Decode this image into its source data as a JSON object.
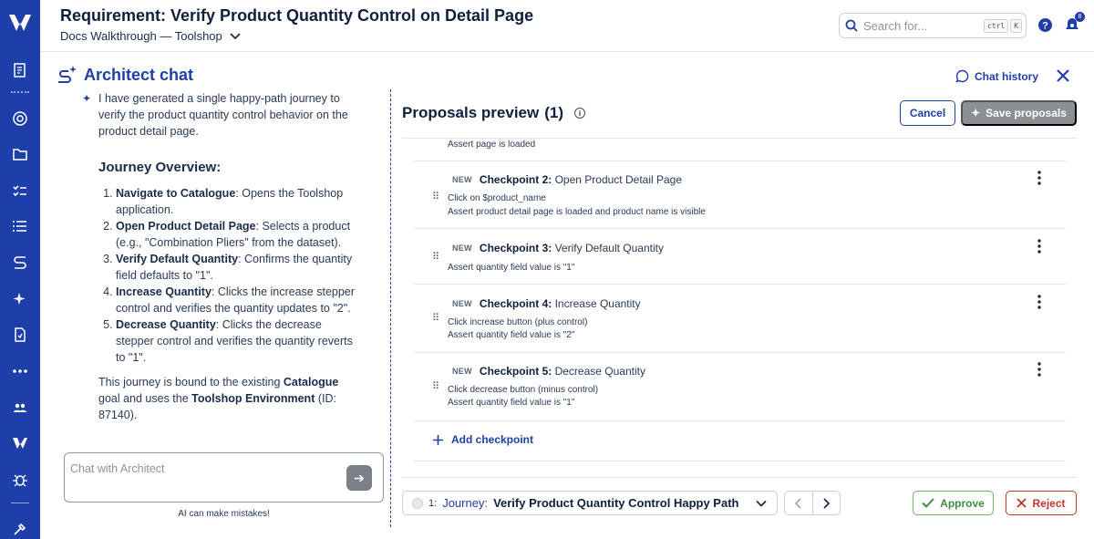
{
  "header": {
    "title": "Requirement: Verify Product Quantity Control on Detail Page",
    "subtitle": "Docs Walkthrough — Toolshop",
    "search_placeholder": "Search for...",
    "kbd_ctrl": "ctrl",
    "kbd_k": "K",
    "notification_count": "8"
  },
  "chat": {
    "title": "Architect chat",
    "intro": "I have generated a single happy-path journey to verify the product quantity control behavior on the product detail page.",
    "overview_heading": "Journey Overview:",
    "steps": [
      {
        "bold": "Navigate to Catalogue",
        "text": ": Opens the Toolshop application."
      },
      {
        "bold": "Open Product Detail Page",
        "text": ": Selects a product (e.g., \"Combination Pliers\" from the dataset)."
      },
      {
        "bold": "Verify Default Quantity",
        "text": ": Confirms the quantity field defaults to \"1\"."
      },
      {
        "bold": "Increase Quantity",
        "text": ": Clicks the increase stepper control and verifies the quantity updates to \"2\"."
      },
      {
        "bold": "Decrease Quantity",
        "text": ": Clicks the decrease stepper control and verifies the quantity reverts to \"1\"."
      }
    ],
    "outro_1": "This journey is bound to the existing ",
    "outro_goal": "Catalogue",
    "outro_2": " goal and uses the ",
    "outro_env": "Toolshop Environment",
    "outro_3": " (ID: 87140).",
    "input_placeholder": "Chat with Architect",
    "disclaimer": "AI can make mistakes!"
  },
  "proposals": {
    "chat_history": "Chat history",
    "title": "Proposals preview",
    "count": "(1)",
    "cancel": "Cancel",
    "save": "Save proposals",
    "prev_step": "Assert page is loaded",
    "new_tag": "NEW",
    "checkpoints": [
      {
        "label": "Checkpoint 2:",
        "name": "Open Product Detail Page",
        "steps": [
          "Click on $product_name",
          "Assert product detail page is loaded and product name is visible"
        ]
      },
      {
        "label": "Checkpoint 3:",
        "name": "Verify Default Quantity",
        "steps": [
          "Assert quantity field value is \"1\""
        ]
      },
      {
        "label": "Checkpoint 4:",
        "name": "Increase Quantity",
        "steps": [
          "Click increase button (plus control)",
          "Assert quantity field value is \"2\""
        ]
      },
      {
        "label": "Checkpoint 5:",
        "name": "Decrease Quantity",
        "steps": [
          "Click decrease button (minus control)",
          "Assert quantity field value is \"1\""
        ]
      }
    ],
    "add_checkpoint": "Add checkpoint",
    "journey_index": "1:",
    "journey_label": "Journey:",
    "journey_name": "Verify Product Quantity Control Happy Path",
    "approve": "Approve",
    "reject": "Reject"
  },
  "colors": {
    "brand": "#1f3fa8",
    "approve": "#3d8f3d",
    "reject": "#c0392b"
  }
}
